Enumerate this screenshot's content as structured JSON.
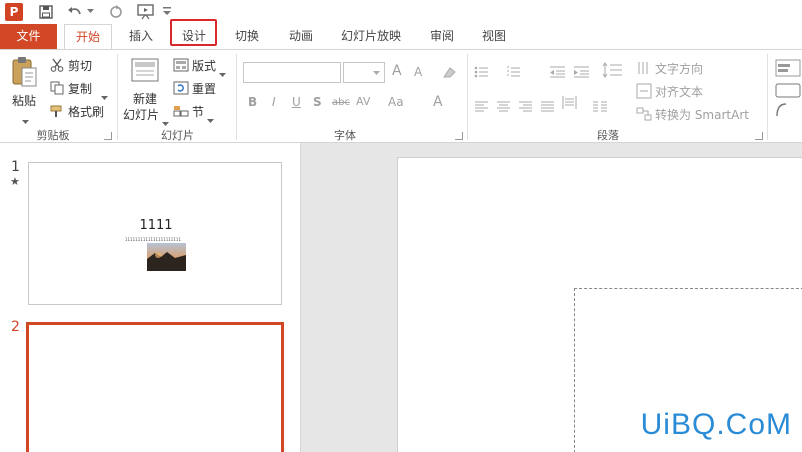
{
  "tabs": {
    "file": "文件",
    "home": "开始",
    "insert": "插入",
    "design": "设计",
    "transitions": "切换",
    "animations": "动画",
    "slideshow": "幻灯片放映",
    "review": "审阅",
    "view": "视图"
  },
  "quick_access": {
    "logo": "P"
  },
  "ribbon": {
    "clipboard": {
      "paste": "粘贴",
      "cut": "剪切",
      "copy": "复制",
      "format_painter": "格式刷",
      "label": "剪贴板"
    },
    "slides": {
      "new_slide_line1": "新建",
      "new_slide_line2": "幻灯片",
      "layout": "版式",
      "reset": "重置",
      "section": "节",
      "label": "幻灯片"
    },
    "font": {
      "label": "字体",
      "bold": "B",
      "italic": "I",
      "underline": "U",
      "shadow": "S",
      "strike": "abc",
      "spacing": "AV",
      "case": "Aa",
      "color": "A",
      "grow": "A",
      "shrink": "A"
    },
    "paragraph": {
      "text_direction": "文字方向",
      "align_text": "对齐文本",
      "convert_smartart": "转换为 SmartArt",
      "label": "段落"
    }
  },
  "slides_pane": {
    "slide1": {
      "number": "1",
      "star": "★",
      "title": "1111",
      "subtitle": "1111111111111111111111"
    },
    "slide2": {
      "number": "2"
    }
  },
  "watermark": "UiBQ.CoM",
  "colors": {
    "accent": "#d24726",
    "highlight_box": "#d9282b",
    "watermark": "#2a8bd6"
  }
}
